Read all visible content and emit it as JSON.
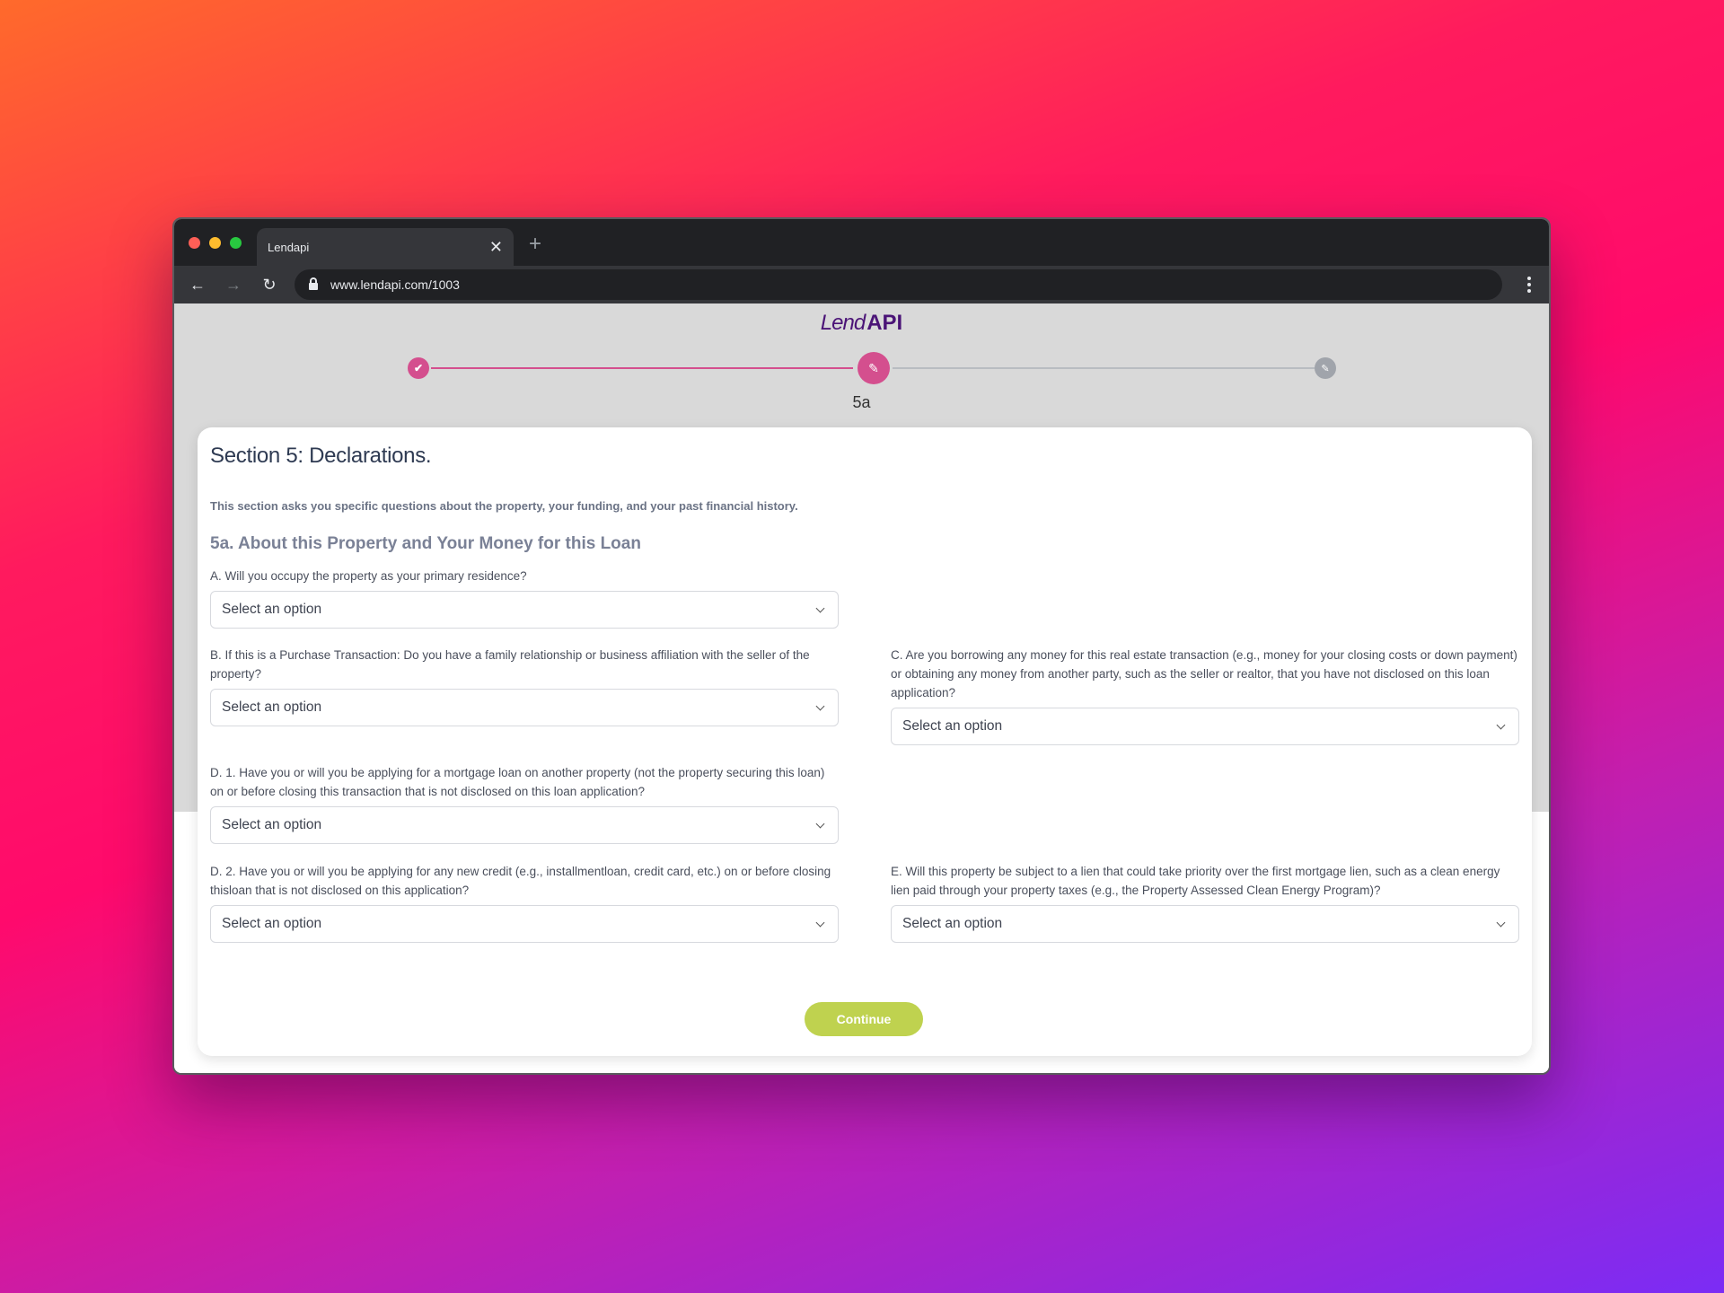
{
  "browser": {
    "tab_title": "Lendapi",
    "url": "www.lendapi.com/1003",
    "close_glyph": "✕",
    "new_tab_glyph": "+",
    "back_glyph": "←",
    "forward_glyph": "→",
    "reload_glyph": "↻"
  },
  "logo": {
    "part1": "Lend",
    "part2": "API"
  },
  "stepper": {
    "steps": [
      {
        "state": "completed",
        "icon": "check-icon",
        "glyph": "✔"
      },
      {
        "state": "active",
        "icon": "pencil-icon",
        "glyph": "✎",
        "label": "5a"
      },
      {
        "state": "pending",
        "icon": "pencil-icon",
        "glyph": "✎"
      }
    ],
    "active_label": "5a",
    "colors": {
      "active": "#d44f8e",
      "pending": "#a0a4ab"
    }
  },
  "form": {
    "title": "Section 5: Declarations.",
    "description": "This section asks you specific questions about the property, your funding, and your past financial history.",
    "subtitle": "5a. About this Property and Your Money for this Loan",
    "questions": [
      {
        "id": "A",
        "label": "A. Will you occupy the property as your primary residence?",
        "value": "Select an option"
      },
      {
        "id": "B",
        "label": "B. If this is a Purchase Transaction: Do you have a family relationship or business affiliation with the seller of the property?",
        "value": "Select an option"
      },
      {
        "id": "C",
        "label": "C. Are you borrowing any money for this real estate transaction (e.g., money for your closing costs or down payment) or obtaining any money from another party, such as the seller or realtor, that you have not disclosed on this loan application?",
        "value": "Select an option"
      },
      {
        "id": "D1",
        "label": "D. 1. Have you or will you be applying for a mortgage loan on another property (not the property securing this loan) on or before closing this transaction that is not disclosed on this loan application?",
        "value": "Select an option"
      },
      {
        "id": "D2",
        "label": "D. 2. Have you or will you be applying for any new credit (e.g., installmentloan, credit card, etc.) on or before closing thisloan that is not disclosed on this application?",
        "value": "Select an option"
      },
      {
        "id": "E",
        "label": "E. Will this property be subject to a lien that could take priority over the first mortgage lien, such as a clean energy lien paid through your property taxes (e.g., the Property Assessed Clean Energy Program)?",
        "value": "Select an option"
      }
    ],
    "continue_label": "Continue",
    "continue_color": "#bfd24f"
  }
}
